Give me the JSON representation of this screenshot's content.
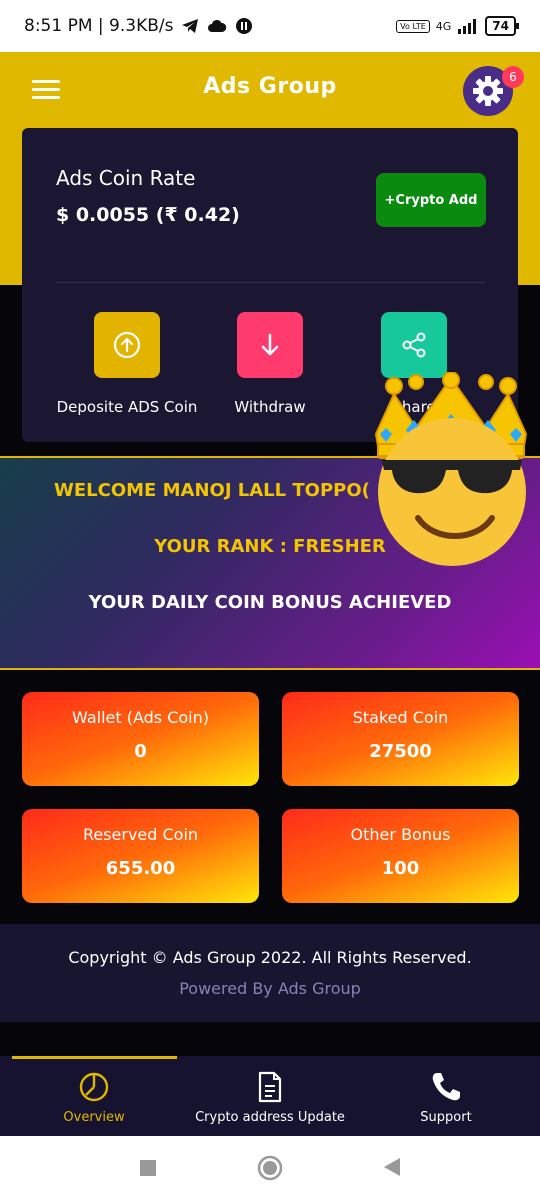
{
  "status_bar": {
    "time_speed": "8:51 PM | 9.3KB/s",
    "network": "4G",
    "volte": "Vo LTE",
    "battery": "74"
  },
  "header": {
    "title": "Ads Group",
    "notification_count": "6"
  },
  "rate_card": {
    "title": "Ads Coin Rate",
    "value": "$ 0.0055 (₹ 0.42)",
    "crypto_button": "+Crypto Add"
  },
  "actions": [
    {
      "label": "Deposite ADS Coin",
      "icon": "arrow-up-circle-icon",
      "color": "#e2b400"
    },
    {
      "label": "Withdraw",
      "icon": "arrow-down-icon",
      "color": "#ff3a6d"
    },
    {
      "label": "Share",
      "icon": "share-icon",
      "color": "#17c99a"
    }
  ],
  "welcome": {
    "name_line": "WELCOME MANOJ LALL TOPPO(",
    "rank_line": "YOUR RANK : FRESHER",
    "bonus_line": "YOUR DAILY COIN BONUS ACHIEVED"
  },
  "stats": [
    {
      "label": "Wallet (Ads Coin)",
      "value": "0"
    },
    {
      "label": "Staked Coin",
      "value": "27500"
    },
    {
      "label": "Reserved Coin",
      "value": "655.00"
    },
    {
      "label": "Other Bonus",
      "value": "100"
    }
  ],
  "footer": {
    "copyright": "Copyright © Ads Group 2022. All Rights Reserved.",
    "powered": "Powered By Ads Group"
  },
  "bottom_nav": [
    {
      "label": "Overview",
      "icon": "pie-chart-icon",
      "active": true
    },
    {
      "label": "Crypto address Update",
      "icon": "document-icon",
      "active": false
    },
    {
      "label": "Support",
      "icon": "phone-icon",
      "active": false
    }
  ],
  "colors": {
    "accent_yellow": "#e1b800",
    "card_dark": "#1b1631",
    "crypto_green": "#0b8a10",
    "active_nav": "#e1b800"
  }
}
